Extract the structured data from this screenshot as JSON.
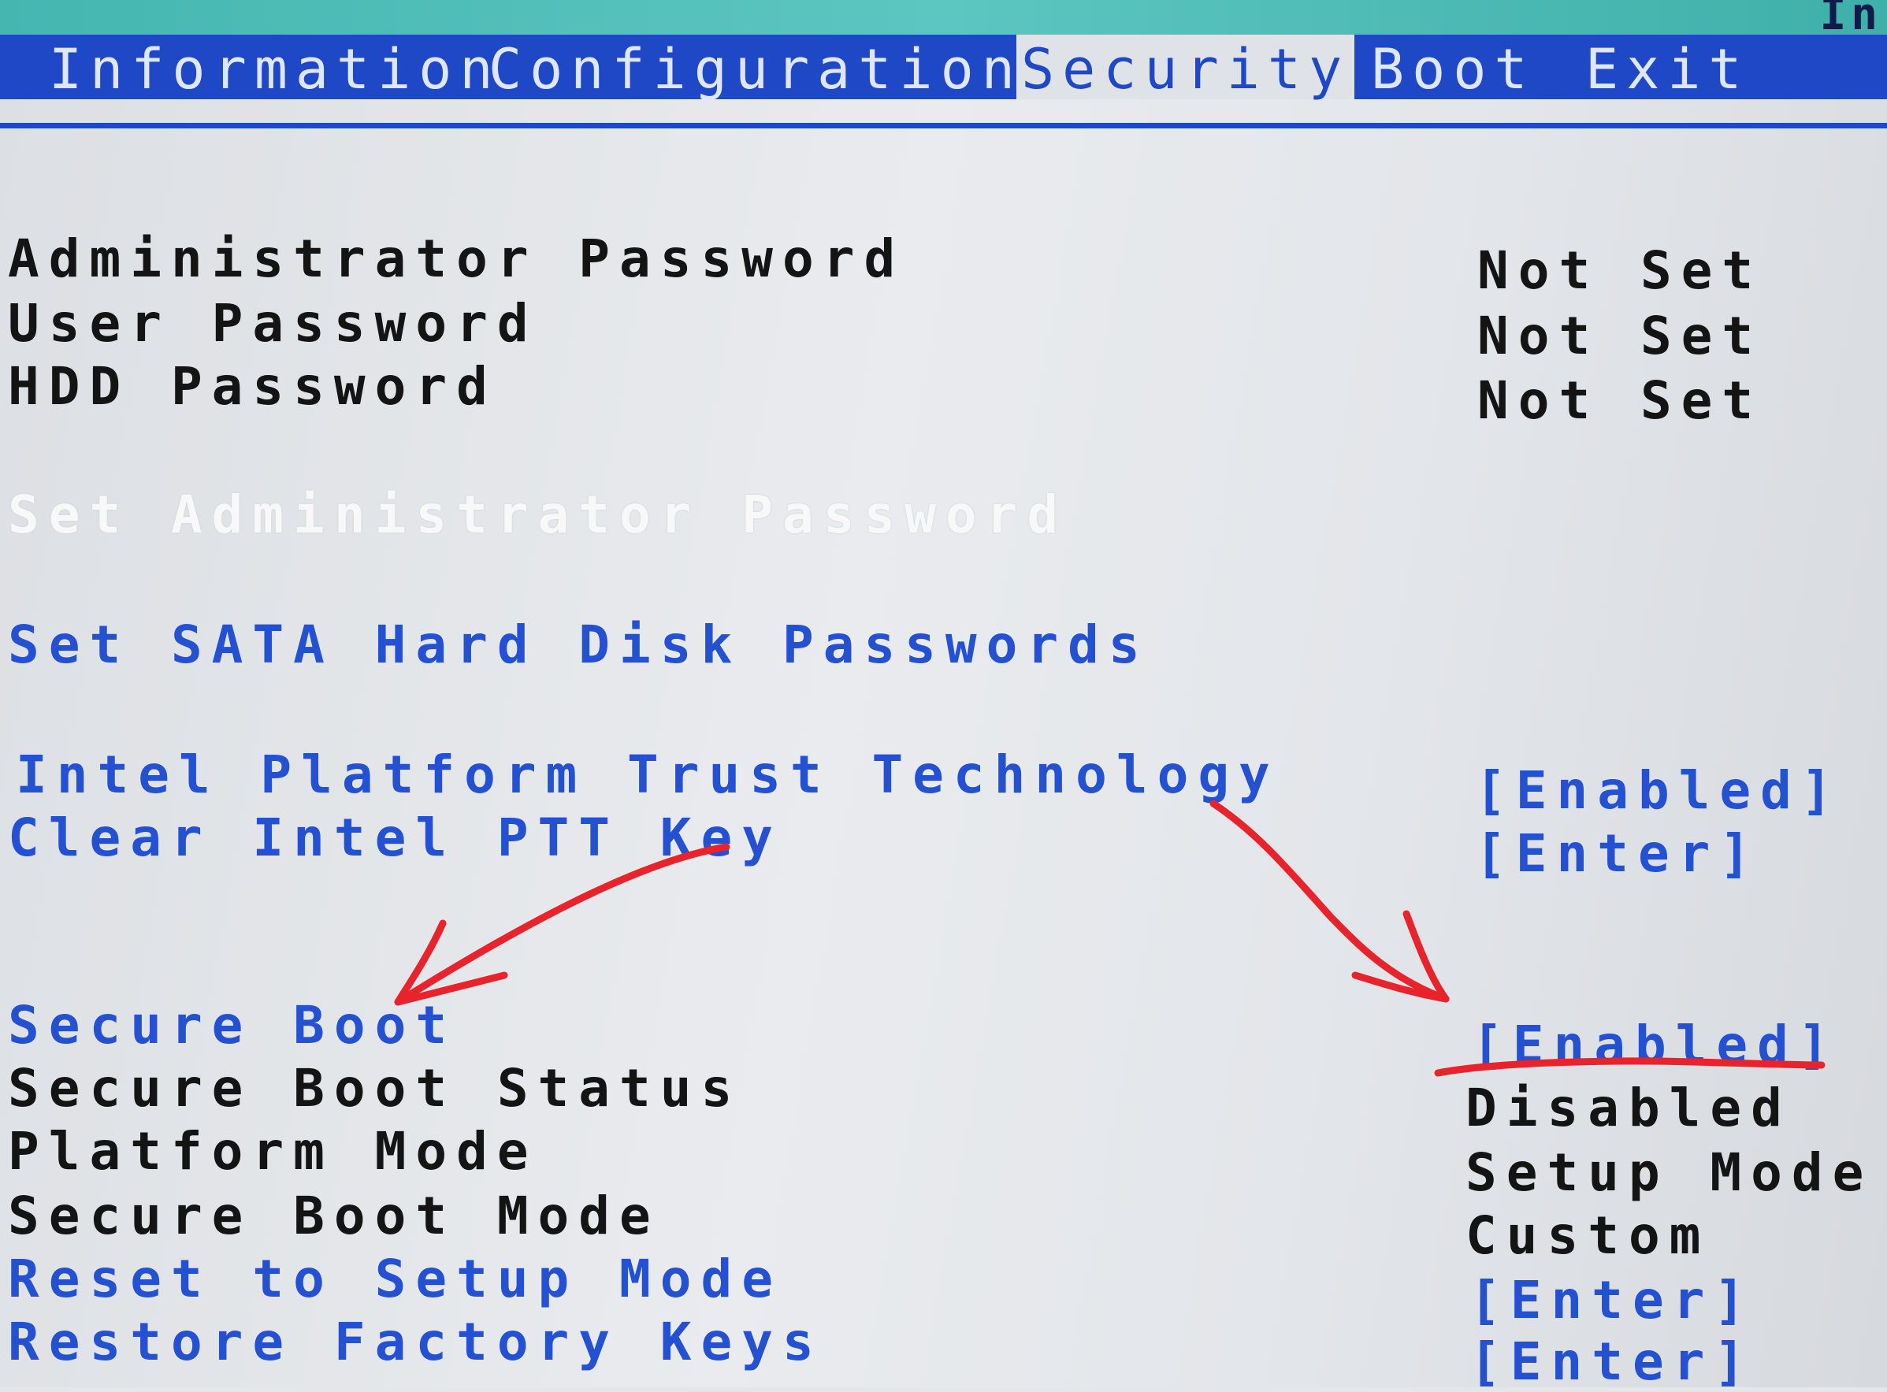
{
  "corner_title": "In",
  "tabs": [
    {
      "label": "Information"
    },
    {
      "label": "Configuration"
    },
    {
      "label": "Security",
      "active": true
    },
    {
      "label": "Boot"
    },
    {
      "label": "Exit"
    }
  ],
  "passwords": [
    {
      "label": "Administrator Password",
      "value": "Not Set"
    },
    {
      "label": "User Password",
      "value": "Not Set"
    },
    {
      "label": "HDD Password",
      "value": "Not Set"
    }
  ],
  "set_admin_password": "Set Administrator Password",
  "set_sata_passwords": "Set SATA Hard Disk Passwords",
  "ptt": [
    {
      "label": "Intel Platform Trust Technology",
      "value": "[Enabled]"
    },
    {
      "label": "Clear Intel PTT Key",
      "value": "[Enter]"
    }
  ],
  "secure_boot": [
    {
      "label": "Secure Boot",
      "value": "[Enabled]"
    },
    {
      "label": "Secure Boot Status",
      "value": "Disabled"
    },
    {
      "label": "Platform Mode",
      "value": "Setup Mode"
    },
    {
      "label": "Secure Boot Mode",
      "value": "Custom"
    },
    {
      "label": "Reset to Setup Mode",
      "value": "[Enter]"
    },
    {
      "label": "Restore Factory Keys",
      "value": "[Enter]"
    }
  ],
  "colors": {
    "menubar": "#1f48c6",
    "highlight_blue": "#2450d2",
    "annotation_red": "#e8232b"
  }
}
